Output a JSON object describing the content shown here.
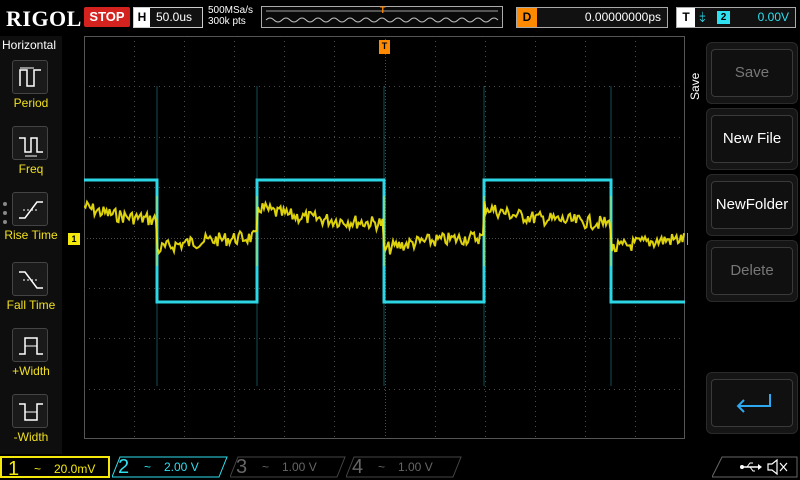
{
  "topbar": {
    "brand": "RIGOL",
    "run_state": "STOP",
    "timebase_label": "H",
    "timebase_value": "50.0us",
    "sample_rate": "500MSa/s",
    "memory_depth": "300k pts",
    "trigger_marker": "T",
    "delay_label": "D",
    "delay_value": "0.00000000ps",
    "trigger_label": "T",
    "trigger_source": "2",
    "trigger_level": "0.00V"
  },
  "left_menu": {
    "title": "Horizontal",
    "items": [
      {
        "label": "Period",
        "icon": "period-icon"
      },
      {
        "label": "Freq",
        "icon": "freq-icon"
      },
      {
        "label": "Rise Time",
        "icon": "rise-time-icon"
      },
      {
        "label": "Fall Time",
        "icon": "fall-time-icon"
      },
      {
        "label": "+Width",
        "icon": "positive-width-icon"
      },
      {
        "label": "-Width",
        "icon": "negative-width-icon"
      }
    ]
  },
  "right_menu": {
    "title": "Save",
    "buttons": [
      {
        "label": "Save",
        "enabled": false
      },
      {
        "label": "New File",
        "enabled": true
      },
      {
        "label": "NewFolder",
        "enabled": true
      },
      {
        "label": "Delete",
        "enabled": false
      }
    ],
    "back_icon": "return-icon"
  },
  "markers": {
    "ch1_marker": "1",
    "trigger_level_marker": "T",
    "top_trigger_marker": "T"
  },
  "channels": [
    {
      "number": "1",
      "coupling": "~",
      "scale": "20.0mV",
      "active": true,
      "color": "#f5e90c"
    },
    {
      "number": "2",
      "coupling": "~",
      "scale": "2.00 V",
      "active": true,
      "color": "#2ee0f0"
    },
    {
      "number": "3",
      "coupling": "~",
      "scale": "1.00 V",
      "active": false,
      "color": "#666666"
    },
    {
      "number": "4",
      "coupling": "~",
      "scale": "1.00 V",
      "active": false,
      "color": "#666666"
    }
  ],
  "status_icons": [
    "usb-icon",
    "mute-icon"
  ],
  "colors": {
    "ch1": "#f5e90c",
    "ch2": "#2ee0f0",
    "trigger": "#ff8a00",
    "stop": "#d4231f"
  }
}
